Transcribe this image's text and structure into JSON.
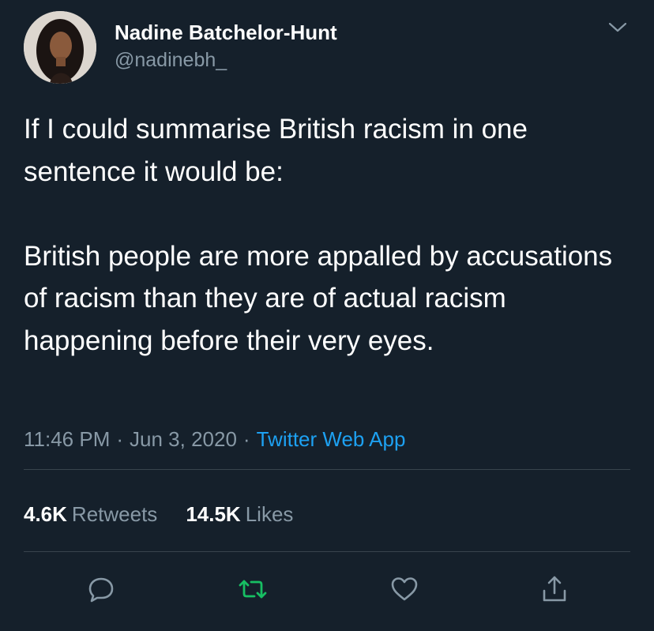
{
  "author": {
    "name": "Nadine Batchelor-Hunt",
    "handle": "@nadinebh_"
  },
  "tweet": {
    "text": "If I could summarise British racism in one sentence it would be:\n\nBritish people are more appalled by accusations of racism than they are of actual racism happening before their very eyes."
  },
  "meta": {
    "time": "11:46 PM",
    "separator": "·",
    "date": "Jun 3, 2020",
    "source": "Twitter Web App"
  },
  "stats": {
    "retweets_count": "4.6K",
    "retweets_label": "Retweets",
    "likes_count": "14.5K",
    "likes_label": "Likes"
  },
  "icons": {
    "reply": "reply-icon",
    "retweet": "retweet-icon",
    "like": "heart-icon",
    "share": "share-icon",
    "more": "chevron-down-icon"
  },
  "colors": {
    "background": "#15202b",
    "text": "#ffffff",
    "secondary": "#8899a6",
    "link": "#1da1f2",
    "retweet_active": "#17bf63",
    "divider": "#38444d"
  }
}
